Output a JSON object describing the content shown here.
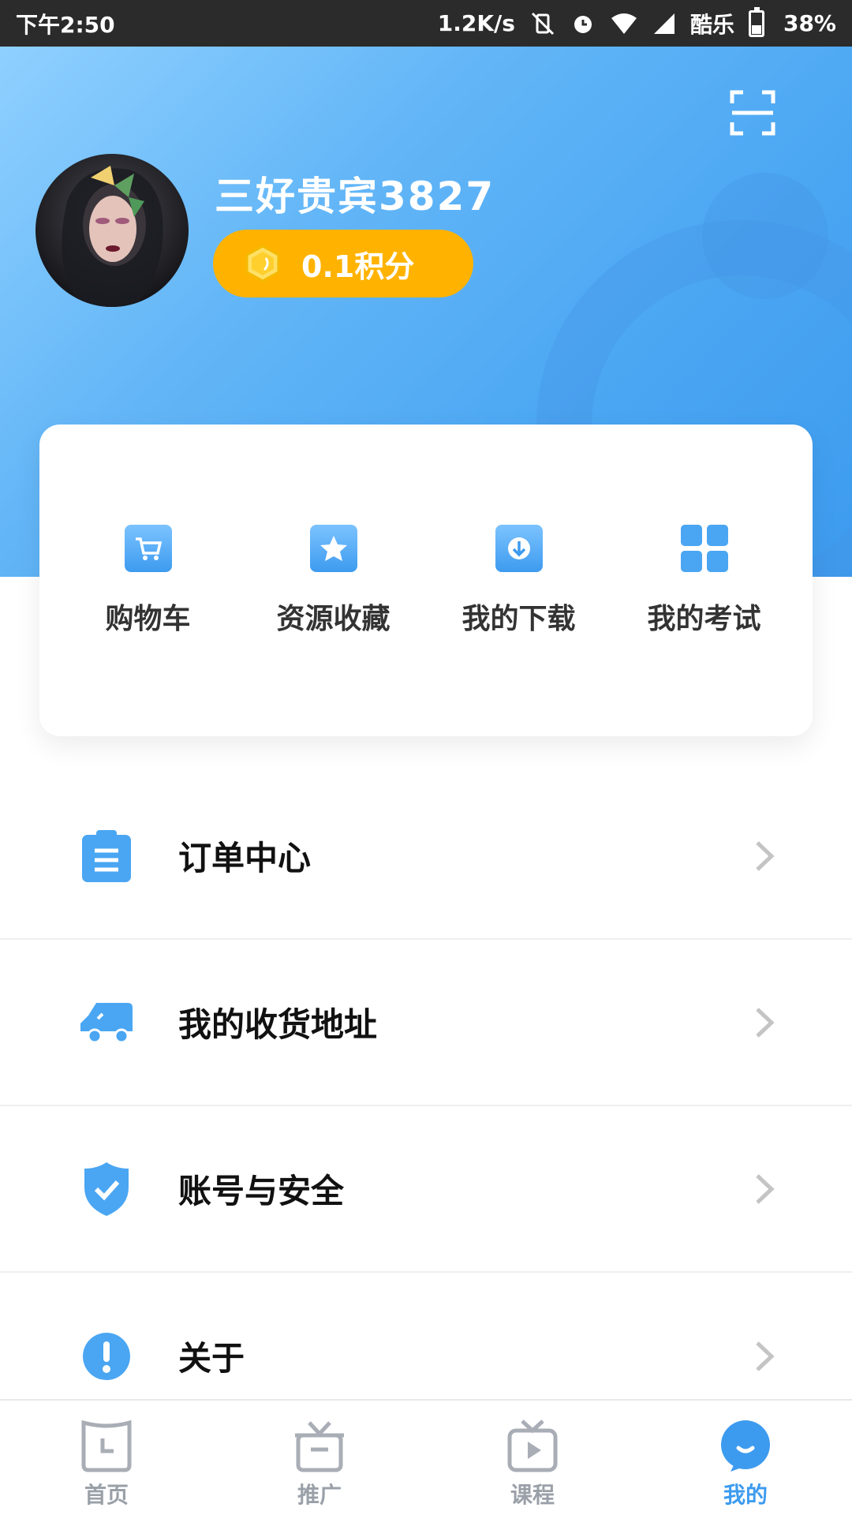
{
  "status_bar": {
    "time": "下午2:50",
    "net_speed": "1.2K/s",
    "carrier": "酷乐",
    "battery": "38%",
    "battery_level": 0.38,
    "icons": [
      "vibrate-off-icon",
      "alarm-icon",
      "wifi-icon",
      "signal-icon",
      "battery-icon"
    ]
  },
  "profile": {
    "username": "三好贵宾3827",
    "points": "0.1积分",
    "scan_icon": "scan-icon",
    "avatar_icon": "avatar"
  },
  "quick_actions": [
    {
      "label": "购物车",
      "icon": "cart-icon"
    },
    {
      "label": "资源收藏",
      "icon": "star-icon"
    },
    {
      "label": "我的下载",
      "icon": "download-icon"
    },
    {
      "label": "我的考试",
      "icon": "grid-icon"
    }
  ],
  "menu": [
    {
      "label": "订单中心",
      "icon": "clipboard-icon"
    },
    {
      "label": "我的收货地址",
      "icon": "truck-icon"
    },
    {
      "label": "账号与安全",
      "icon": "shield-icon"
    },
    {
      "label": "关于",
      "icon": "info-icon"
    }
  ],
  "bottom_nav": [
    {
      "label": "首页",
      "icon": "home-icon",
      "active": false
    },
    {
      "label": "推广",
      "icon": "gift-icon",
      "active": false
    },
    {
      "label": "课程",
      "icon": "tv-icon",
      "active": false
    },
    {
      "label": "我的",
      "icon": "profile-icon",
      "active": true
    }
  ],
  "colors": {
    "accent": "#3d9bef",
    "header_light": "#8fd0ff",
    "points_bg": "#ffb300",
    "nav_inactive": "#9aa0a8"
  }
}
